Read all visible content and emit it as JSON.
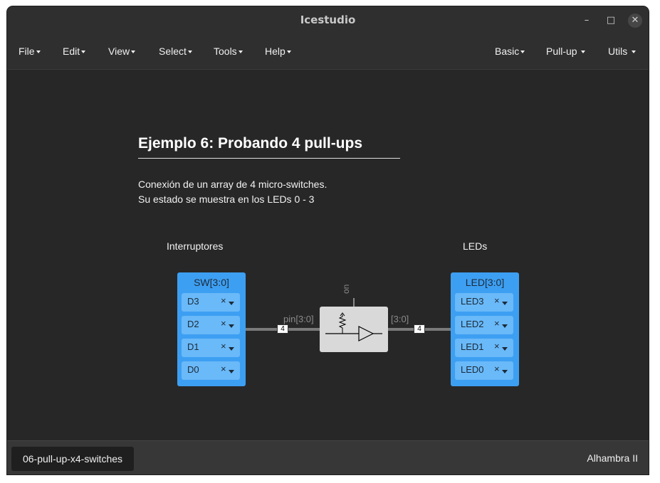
{
  "window": {
    "title": "Icestudio",
    "minimize": "–",
    "maximize": "□",
    "close": "✕"
  },
  "menu": {
    "left": [
      "File",
      "Edit",
      "View",
      "Select",
      "Tools",
      "Help"
    ],
    "right": [
      "Basic",
      "Pull-up",
      "Utils"
    ]
  },
  "canvas": {
    "heading": "Ejemplo 6: Probando 4 pull-ups",
    "description": [
      "Conexión de un array de 4 micro-switches.",
      "Su estado se muestra en los LEDs 0 - 3"
    ],
    "left_label": "Interruptores",
    "right_label": "LEDs",
    "input_port": {
      "title": "SW[3:0]",
      "pins": [
        "D3",
        "D2",
        "D1",
        "D0"
      ]
    },
    "output_port": {
      "title": "LED[3:0]",
      "pins": [
        "LED3",
        "LED2",
        "LED1",
        "LED0"
      ]
    },
    "pin_remove_glyph": "×",
    "pullup_block": {
      "in_label": "pin[3:0]",
      "out_label": "[3:0]",
      "top_label": "on"
    },
    "wire_sizes": [
      "4",
      "4"
    ]
  },
  "status": {
    "file_tab": "06-pull-up-x4-switches",
    "board": "Alhambra II"
  },
  "colors": {
    "port_blue": "#3d9ff2",
    "pin_blue": "#6ab9f8",
    "canvas_bg": "#272727",
    "block_gray": "#d9d9d9"
  }
}
